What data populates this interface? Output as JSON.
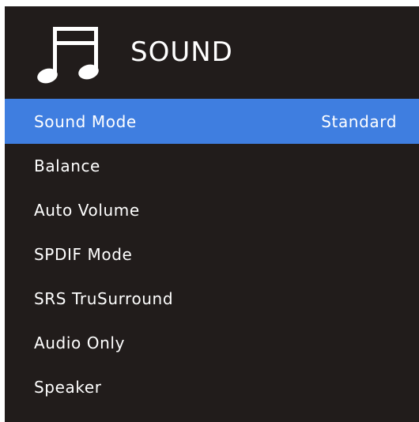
{
  "header": {
    "icon": "music-note-icon",
    "title": "SOUND"
  },
  "menu": {
    "selected_index": 0,
    "items": [
      {
        "label": "Sound Mode",
        "value": "Standard"
      },
      {
        "label": "Balance",
        "value": ""
      },
      {
        "label": "Auto Volume",
        "value": ""
      },
      {
        "label": "SPDIF Mode",
        "value": ""
      },
      {
        "label": "SRS TruSurround",
        "value": ""
      },
      {
        "label": "Audio Only",
        "value": ""
      },
      {
        "label": "Speaker",
        "value": ""
      }
    ]
  },
  "colors": {
    "background": "#211c1b",
    "highlight": "#3f7ee0",
    "text": "#ffffff"
  }
}
